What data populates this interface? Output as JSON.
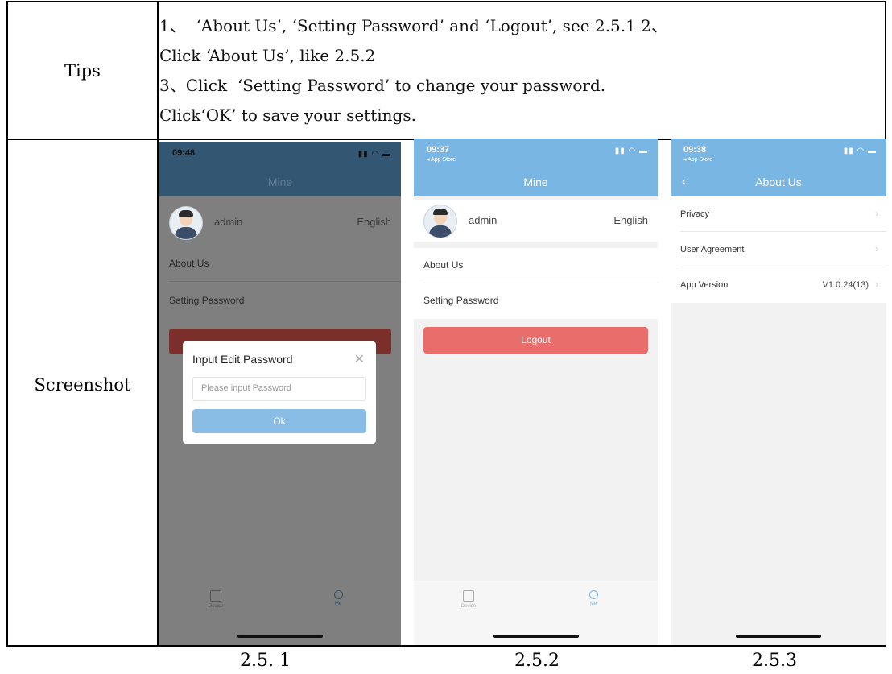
{
  "table": {
    "tips_label": "Tips",
    "screenshot_label": "Screenshot",
    "tips_lines": [
      "1、  ‘About Us’, ‘Setting Password’ and ‘Logout’, see 2.5.1 2、",
      "Click ‘About Us’, like 2.5.2",
      "3、Click  ‘Setting Password’ to change your password.",
      "Click‘OK’ to save your settings."
    ]
  },
  "captions": [
    "2.5. 1",
    "2.5.2",
    "2.5.3"
  ],
  "phone1": {
    "time": "09:48",
    "title": "Mine",
    "username": "admin",
    "language": "English",
    "menu": [
      "About Us",
      "Setting Password"
    ],
    "dialog": {
      "title": "Input Edit Password",
      "placeholder": "Please input Password",
      "ok_label": "Ok"
    },
    "tabs": [
      "Device",
      "Me"
    ]
  },
  "phone2": {
    "time": "09:37",
    "status_sub": "◂ App Store",
    "title": "Mine",
    "username": "admin",
    "language": "English",
    "menu": [
      "About Us",
      "Setting Password"
    ],
    "logout_label": "Logout",
    "tabs": [
      "Device",
      "Me"
    ]
  },
  "phone3": {
    "time": "09:38",
    "status_sub": "◂ App Store",
    "back": "‹",
    "title": "About Us",
    "rows": [
      {
        "label": "Privacy",
        "value": ""
      },
      {
        "label": "User Agreement",
        "value": ""
      },
      {
        "label": "App Version",
        "value": "V1.0.24(13)"
      }
    ]
  },
  "colors": {
    "nav_blue": "#7ab6e4",
    "logout_red": "#e96e6b",
    "dim_overlay": "#7f7f7f"
  },
  "icons": [
    "signal-wifi-battery-icon",
    "avatar-icon",
    "device-tab-icon",
    "me-tab-icon",
    "close-icon",
    "back-chevron-icon",
    "chevron-right-icon"
  ]
}
